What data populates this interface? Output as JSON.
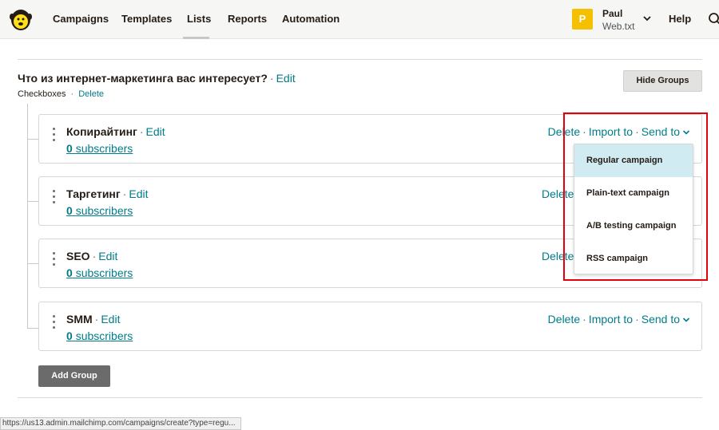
{
  "nav": {
    "items": [
      {
        "label": "Campaigns"
      },
      {
        "label": "Templates"
      },
      {
        "label": "Lists"
      },
      {
        "label": "Reports"
      },
      {
        "label": "Automation"
      }
    ],
    "active": "Lists"
  },
  "user": {
    "avatar_letter": "P",
    "name": "Paul",
    "org": "Web.txt",
    "avatar_color": "#f5c000"
  },
  "help_label": "Help",
  "group": {
    "title": "Что из интернет-маркетинга вас интересует?",
    "edit_label": "Edit",
    "type": "Checkboxes",
    "delete_label": "Delete",
    "hide_button": "Hide Groups",
    "add_button": "Add Group"
  },
  "interests": [
    {
      "name": "Копирайтинг",
      "edit": "Edit",
      "count": "0",
      "subs_label": "subscribers",
      "delete": "Delete",
      "import": "Import to",
      "send": "Send to"
    },
    {
      "name": "Таргетинг",
      "edit": "Edit",
      "count": "0",
      "subs_label": "subscribers",
      "delete": "Delete"
    },
    {
      "name": "SEO",
      "edit": "Edit",
      "count": "0",
      "subs_label": "subscribers",
      "delete": "Delete"
    },
    {
      "name": "SMM",
      "edit": "Edit",
      "count": "0",
      "subs_label": "subscribers",
      "delete": "Delete",
      "import": "Import to",
      "send": "Send to"
    }
  ],
  "send_menu": {
    "items": [
      {
        "label": "Regular campaign"
      },
      {
        "label": "Plain-text campaign"
      },
      {
        "label": "A/B testing campaign"
      },
      {
        "label": "RSS campaign"
      }
    ]
  },
  "status_url": "https://us13.admin.mailchimp.com/campaigns/create?type=regu...",
  "colors": {
    "link": "#007c89",
    "highlight": "#e6000a",
    "menu_hover": "#d0ecf2"
  }
}
